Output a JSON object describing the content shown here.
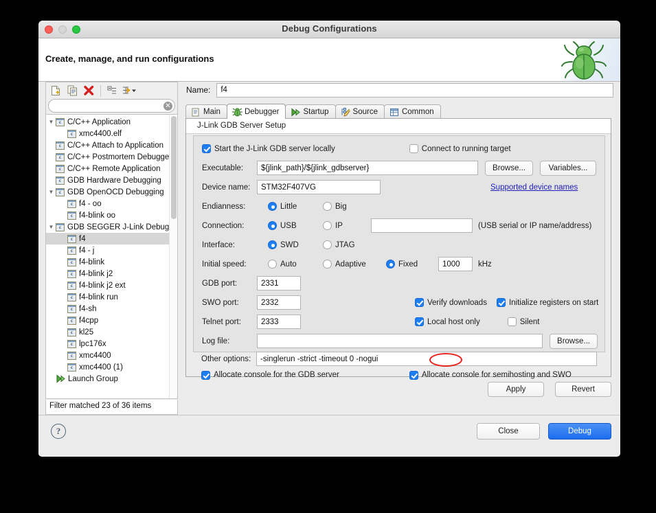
{
  "window": {
    "title": "Debug Configurations",
    "traffic_lights": [
      "close-red",
      "minimize-gray",
      "zoom-green"
    ]
  },
  "banner": {
    "heading": "Create, manage, and run configurations",
    "icon": "green-bug-icon"
  },
  "tree_toolbar": {
    "buttons": [
      {
        "name": "new-configuration-icon",
        "tip": "New launch configuration"
      },
      {
        "name": "duplicate-configuration-icon",
        "tip": "Duplicate"
      },
      {
        "name": "delete-configuration-icon",
        "tip": "Delete"
      },
      {
        "name": "collapse-all-icon",
        "tip": "Collapse All"
      },
      {
        "name": "filter-configurations-icon",
        "tip": "Filter"
      }
    ]
  },
  "filter": {
    "value": "",
    "placeholder": "",
    "clear_icon": "clear-icon",
    "status": "Filter matched 23 of 36 items"
  },
  "tree": {
    "items": [
      {
        "label": "C/C++ Application",
        "depth": 0,
        "twisty": "▼",
        "icon": "c-config-icon",
        "selected": false
      },
      {
        "label": "xmc4400.elf",
        "depth": 1,
        "twisty": "",
        "icon": "c-config-icon",
        "selected": false
      },
      {
        "label": "C/C++ Attach to Application",
        "depth": 0,
        "twisty": "",
        "icon": "c-config-icon",
        "selected": false
      },
      {
        "label": "C/C++ Postmortem Debugger",
        "depth": 0,
        "twisty": "",
        "icon": "c-config-icon",
        "selected": false
      },
      {
        "label": "C/C++ Remote Application",
        "depth": 0,
        "twisty": "",
        "icon": "c-config-icon",
        "selected": false
      },
      {
        "label": "GDB Hardware Debugging",
        "depth": 0,
        "twisty": "",
        "icon": "c-config-icon",
        "selected": false
      },
      {
        "label": "GDB OpenOCD Debugging",
        "depth": 0,
        "twisty": "▼",
        "icon": "c-config-icon",
        "selected": false
      },
      {
        "label": "f4 - oo",
        "depth": 1,
        "twisty": "",
        "icon": "c-config-icon",
        "selected": false
      },
      {
        "label": "f4-blink oo",
        "depth": 1,
        "twisty": "",
        "icon": "c-config-icon",
        "selected": false
      },
      {
        "label": "GDB SEGGER J-Link Debugging",
        "depth": 0,
        "twisty": "▼",
        "icon": "c-config-icon",
        "selected": false
      },
      {
        "label": "f4",
        "depth": 1,
        "twisty": "",
        "icon": "c-config-icon",
        "selected": true
      },
      {
        "label": "f4 - j",
        "depth": 1,
        "twisty": "",
        "icon": "c-config-icon",
        "selected": false
      },
      {
        "label": "f4-blink",
        "depth": 1,
        "twisty": "",
        "icon": "c-config-icon",
        "selected": false
      },
      {
        "label": "f4-blink j2",
        "depth": 1,
        "twisty": "",
        "icon": "c-config-icon",
        "selected": false
      },
      {
        "label": "f4-blink j2 ext",
        "depth": 1,
        "twisty": "",
        "icon": "c-config-icon",
        "selected": false
      },
      {
        "label": "f4-blink run",
        "depth": 1,
        "twisty": "",
        "icon": "c-config-icon",
        "selected": false
      },
      {
        "label": "f4-sh",
        "depth": 1,
        "twisty": "",
        "icon": "c-config-icon",
        "selected": false
      },
      {
        "label": "f4cpp",
        "depth": 1,
        "twisty": "",
        "icon": "c-config-icon",
        "selected": false
      },
      {
        "label": "kl25",
        "depth": 1,
        "twisty": "",
        "icon": "c-config-icon",
        "selected": false
      },
      {
        "label": "lpc176x",
        "depth": 1,
        "twisty": "",
        "icon": "c-config-icon",
        "selected": false
      },
      {
        "label": "xmc4400",
        "depth": 1,
        "twisty": "",
        "icon": "c-config-icon",
        "selected": false
      },
      {
        "label": "xmc4400 (1)",
        "depth": 1,
        "twisty": "",
        "icon": "c-config-icon",
        "selected": false
      },
      {
        "label": "Launch Group",
        "depth": 0,
        "twisty": "",
        "icon": "launch-group-icon",
        "selected": false
      }
    ]
  },
  "name_field": {
    "label": "Name:",
    "value": "f4",
    "placeholder": ""
  },
  "tabs": [
    {
      "label": "Main",
      "icon": "document-icon",
      "active": false
    },
    {
      "label": "Debugger",
      "icon": "bug-icon",
      "active": true
    },
    {
      "label": "Startup",
      "icon": "run-icon",
      "active": false
    },
    {
      "label": "Source",
      "icon": "source-icon",
      "active": false
    },
    {
      "label": "Common",
      "icon": "common-icon",
      "active": false
    }
  ],
  "debugger": {
    "group_title": "J-Link GDB Server Setup",
    "start_server": {
      "label": "Start the J-Link GDB server locally",
      "checked": true
    },
    "connect_running": {
      "label": "Connect to running target",
      "checked": false
    },
    "executable": {
      "label": "Executable:",
      "value": "${jlink_path}/${jlink_gdbserver}",
      "placeholder": "",
      "browse_label": "Browse...",
      "variables_label": "Variables..."
    },
    "device_name": {
      "label": "Device name:",
      "value": "STM32F407VG",
      "placeholder": "",
      "link_label": "Supported device names"
    },
    "endianness": {
      "label": "Endianness:",
      "options": [
        "Little",
        "Big"
      ],
      "selected": "Little"
    },
    "connection": {
      "label": "Connection:",
      "options": [
        "USB",
        "IP"
      ],
      "selected": "USB",
      "address_value": "",
      "address_placeholder": "",
      "hint": "(USB serial or IP name/address)"
    },
    "interface": {
      "label": "Interface:",
      "options": [
        "SWD",
        "JTAG"
      ],
      "selected": "SWD"
    },
    "initial_speed": {
      "label": "Initial speed:",
      "options": [
        "Auto",
        "Adaptive",
        "Fixed"
      ],
      "selected": "Fixed",
      "value": "1000",
      "unit": "kHz"
    },
    "gdb_port": {
      "label": "GDB port:",
      "value": "2331"
    },
    "swo_port": {
      "label": "SWO port:",
      "value": "2332"
    },
    "telnet_port": {
      "label": "Telnet port:",
      "value": "2333"
    },
    "verify_downloads": {
      "label": "Verify downloads",
      "checked": true
    },
    "init_registers": {
      "label": "Initialize registers on start",
      "checked": true
    },
    "local_host_only": {
      "label": "Local host only",
      "checked": true
    },
    "silent": {
      "label": "Silent",
      "checked": false
    },
    "log_file": {
      "label": "Log file:",
      "value": "",
      "placeholder": "",
      "browse_label": "Browse..."
    },
    "other_options": {
      "label": "Other options:",
      "value": "-singlerun -strict -timeout 0 -nogui",
      "placeholder": "",
      "annotation": {
        "shape": "red-ellipse",
        "target_text": "-nogui",
        "color": "#e8241f"
      }
    },
    "console_gdb": {
      "label": "Allocate console for the GDB server",
      "checked": true
    },
    "console_semi": {
      "label": "Allocate console for semihosting and SWO",
      "checked": true
    }
  },
  "panel_buttons": {
    "apply": "Apply",
    "revert": "Revert"
  },
  "dialog_buttons": {
    "help": "?",
    "close": "Close",
    "debug": "Debug"
  },
  "colors": {
    "accent": "#1d7ef3",
    "annotation": "#e8241f",
    "link": "#1c1cbf",
    "selection": "#d6d6d6"
  }
}
